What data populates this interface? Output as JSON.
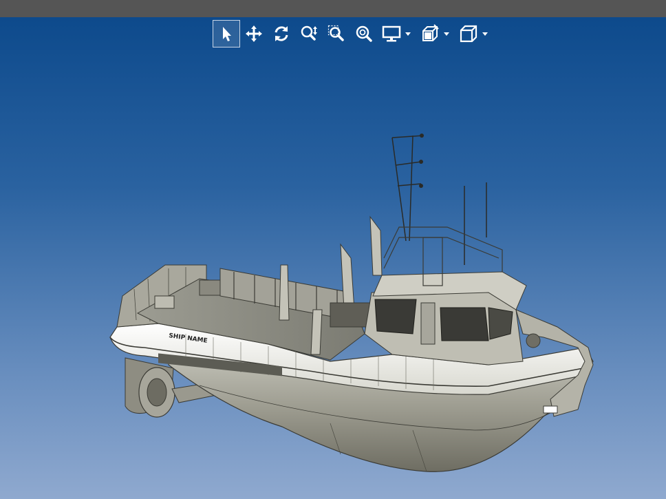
{
  "toolbar": {
    "tools": [
      {
        "name": "select-tool",
        "icon": "cursor-arrow-icon",
        "active": true
      },
      {
        "name": "pan-tool",
        "icon": "move-arrows-icon",
        "active": false
      },
      {
        "name": "rotate-tool",
        "icon": "rotate-icon",
        "active": false
      },
      {
        "name": "zoom-tool",
        "icon": "zoom-updown-icon",
        "active": false
      },
      {
        "name": "zoom-window-tool",
        "icon": "zoom-window-icon",
        "active": false
      },
      {
        "name": "zoom-fit-tool",
        "icon": "zoom-fit-icon",
        "active": false
      }
    ],
    "dropdowns": [
      {
        "name": "display-mode-dropdown",
        "icon": "monitor-icon"
      },
      {
        "name": "section-dropdown",
        "icon": "section-cut-icon"
      },
      {
        "name": "view-orientation-dropdown",
        "icon": "cube-icon"
      }
    ]
  },
  "model": {
    "hull_label": "SHIP NAME"
  },
  "colors": {
    "titlebar": "#555555",
    "viewport_top": "#0d4a8c",
    "viewport_bottom": "#8fa9cf",
    "icon": "#ffffff"
  }
}
